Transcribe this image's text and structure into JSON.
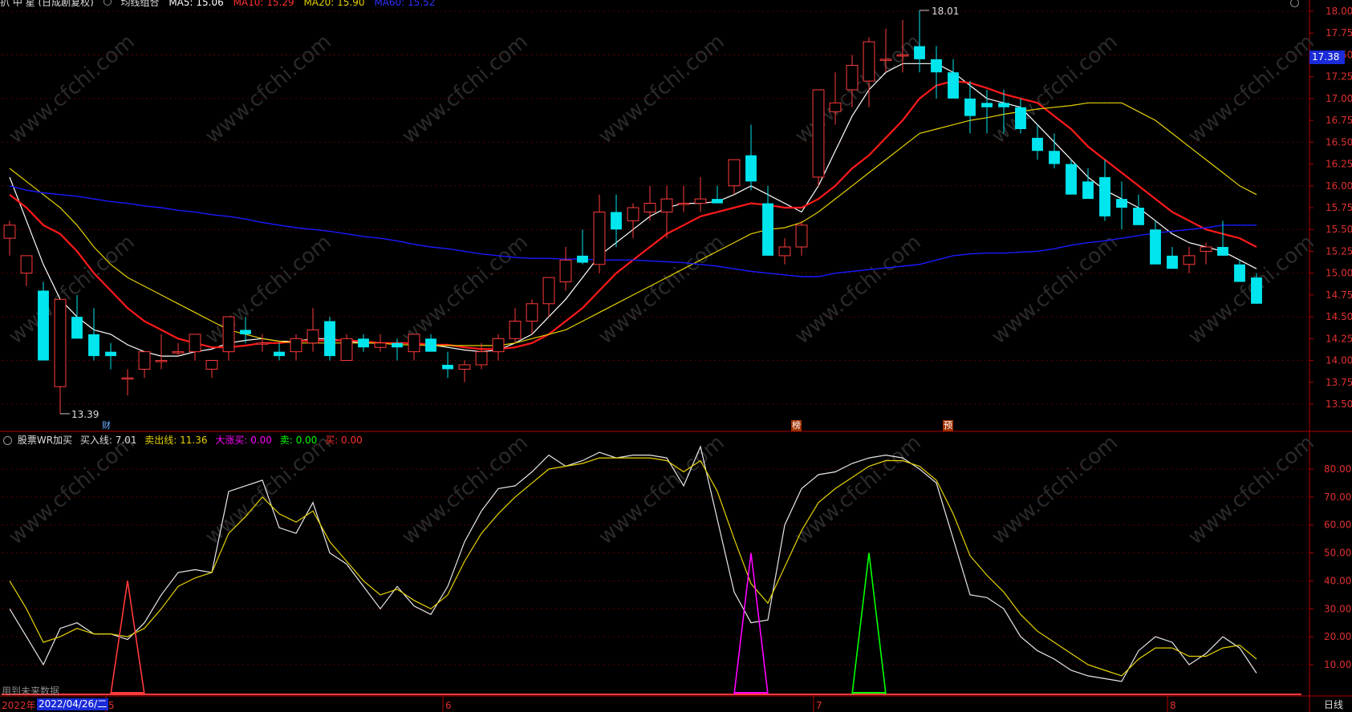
{
  "header": {
    "code_label": "扒 中 星 (日成剧复权)",
    "ma_title": "均线组合",
    "ma5": "MA5: 15.06",
    "ma10": "MA10: 15.29",
    "ma20": "MA20: 15.90",
    "ma60": "MA60: 15.52"
  },
  "price_axis": {
    "ticks": [
      "18.00",
      "17.75",
      "17.50",
      "17.25",
      "17.00",
      "16.75",
      "16.50",
      "16.25",
      "16.00",
      "15.75",
      "15.50",
      "15.25",
      "15.00",
      "14.75",
      "14.50",
      "14.25",
      "14.00",
      "13.75",
      "13.50"
    ],
    "current_price": "17.38"
  },
  "annotations": {
    "high_label": "18.01",
    "low_label": "13.39",
    "marker_cai": "财",
    "marker_bang": "榜",
    "marker_yu": "预"
  },
  "indicator": {
    "name": "股票WR加买",
    "buy_line": "买入线: 7.01",
    "sell_line": "卖出线: 11.36",
    "big_buy": "大涨买: 0.00",
    "sell": "卖: 0.00",
    "buy": "买: 0.00",
    "ticks": [
      "80.00",
      "70.00",
      "60.00",
      "50.00",
      "40.00",
      "30.00",
      "20.00",
      "10.00"
    ]
  },
  "time_axis": {
    "year": "2022年",
    "cursor_date": "2022/04/26/二",
    "months": [
      "5",
      "6",
      "7",
      "8"
    ],
    "period": "日线"
  },
  "footer": {
    "future_data_note": "用到未来数据"
  },
  "colors": {
    "up": "#ff3b3b",
    "down": "#00e5ee",
    "ma5": "#ffffff",
    "ma10": "#ff1a1a",
    "ma20": "#e6d200",
    "ma60": "#1a1aff",
    "axis_red": "#b00000",
    "magenta": "#ff00ff",
    "green": "#00ff00"
  },
  "chart_data": [
    {
      "type": "candlestick",
      "ylim": [
        13.3,
        18.1
      ],
      "candles": [
        [
          15.4,
          15.6,
          15.2,
          15.55
        ],
        [
          15.0,
          15.0,
          14.85,
          15.2
        ],
        [
          14.8,
          14.9,
          14.0,
          14.0
        ],
        [
          13.7,
          14.7,
          13.39,
          14.7
        ],
        [
          14.5,
          14.75,
          14.3,
          14.25
        ],
        [
          14.3,
          14.6,
          14.0,
          14.05
        ],
        [
          14.1,
          14.2,
          13.9,
          14.05
        ],
        [
          13.8,
          13.9,
          13.6,
          13.8
        ],
        [
          13.9,
          14.1,
          13.8,
          14.1
        ],
        [
          14.0,
          14.3,
          13.9,
          14.0
        ],
        [
          14.1,
          14.2,
          14.05,
          14.1
        ],
        [
          14.1,
          14.3,
          14.0,
          14.3
        ],
        [
          13.9,
          14.0,
          13.8,
          14.0
        ],
        [
          14.1,
          14.5,
          14.0,
          14.5
        ],
        [
          14.35,
          14.5,
          14.2,
          14.3
        ],
        [
          14.2,
          14.3,
          14.1,
          14.2
        ],
        [
          14.1,
          14.2,
          14.0,
          14.05
        ],
        [
          14.1,
          14.3,
          14.0,
          14.25
        ],
        [
          14.2,
          14.6,
          14.1,
          14.35
        ],
        [
          14.45,
          14.5,
          14.0,
          14.05
        ],
        [
          14.0,
          14.3,
          14.0,
          14.25
        ],
        [
          14.25,
          14.3,
          14.1,
          14.15
        ],
        [
          14.15,
          14.3,
          14.1,
          14.2
        ],
        [
          14.2,
          14.25,
          14.0,
          14.15
        ],
        [
          14.1,
          14.3,
          14.0,
          14.3
        ],
        [
          14.25,
          14.3,
          14.1,
          14.1
        ],
        [
          13.95,
          14.1,
          13.8,
          13.9
        ],
        [
          13.9,
          14.0,
          13.75,
          13.95
        ],
        [
          13.95,
          14.2,
          13.9,
          14.1
        ],
        [
          14.1,
          14.3,
          14.0,
          14.25
        ],
        [
          14.25,
          14.6,
          14.2,
          14.45
        ],
        [
          14.45,
          14.7,
          14.3,
          14.65
        ],
        [
          14.65,
          14.9,
          14.5,
          14.95
        ],
        [
          14.9,
          15.3,
          14.8,
          15.15
        ],
        [
          15.2,
          15.5,
          15.1,
          15.12
        ],
        [
          15.1,
          15.9,
          15.0,
          15.7
        ],
        [
          15.7,
          15.9,
          15.3,
          15.5
        ],
        [
          15.6,
          15.8,
          15.4,
          15.75
        ],
        [
          15.7,
          16.0,
          15.6,
          15.8
        ],
        [
          15.7,
          16.0,
          15.4,
          15.85
        ],
        [
          15.8,
          16.0,
          15.7,
          15.8
        ],
        [
          15.8,
          16.1,
          15.7,
          15.85
        ],
        [
          15.85,
          16.0,
          15.8,
          15.8
        ],
        [
          16.0,
          16.3,
          15.9,
          16.3
        ],
        [
          16.35,
          16.7,
          15.95,
          16.05
        ],
        [
          15.8,
          16.0,
          15.2,
          15.2
        ],
        [
          15.2,
          15.4,
          15.1,
          15.3
        ],
        [
          15.3,
          15.6,
          15.2,
          15.55
        ],
        [
          16.1,
          17.1,
          16.0,
          17.1
        ],
        [
          16.85,
          17.3,
          16.7,
          16.95
        ],
        [
          17.1,
          17.5,
          16.9,
          17.38
        ],
        [
          17.2,
          17.7,
          16.9,
          17.65
        ],
        [
          17.45,
          17.8,
          17.3,
          17.45
        ],
        [
          17.5,
          17.9,
          17.3,
          17.5
        ],
        [
          17.6,
          18.01,
          17.3,
          17.45
        ],
        [
          17.45,
          17.6,
          17.0,
          17.3
        ],
        [
          17.3,
          17.45,
          17.2,
          17.0
        ],
        [
          17.0,
          17.2,
          16.6,
          16.8
        ],
        [
          16.95,
          17.1,
          16.6,
          16.9
        ],
        [
          16.95,
          17.1,
          16.6,
          16.9
        ],
        [
          16.9,
          17.0,
          16.6,
          16.65
        ],
        [
          16.55,
          16.7,
          16.3,
          16.4
        ],
        [
          16.4,
          16.6,
          16.2,
          16.25
        ],
        [
          16.25,
          16.3,
          15.9,
          15.9
        ],
        [
          16.05,
          16.2,
          15.9,
          15.85
        ],
        [
          16.1,
          16.3,
          15.6,
          15.65
        ],
        [
          15.85,
          16.05,
          15.5,
          15.75
        ],
        [
          15.75,
          15.9,
          15.6,
          15.55
        ],
        [
          15.5,
          15.6,
          15.1,
          15.1
        ],
        [
          15.2,
          15.3,
          15.05,
          15.05
        ],
        [
          15.1,
          15.3,
          15.0,
          15.2
        ],
        [
          15.25,
          15.35,
          15.1,
          15.3
        ],
        [
          15.3,
          15.6,
          15.2,
          15.2
        ],
        [
          15.1,
          15.15,
          14.9,
          14.9
        ],
        [
          14.95,
          15.0,
          14.65,
          14.65
        ]
      ],
      "candle_order": "open,high,low,close",
      "ma_series": [
        {
          "name": "MA5",
          "values": [
            16.1,
            15.6,
            15.1,
            14.7,
            14.5,
            14.35,
            14.3,
            14.18,
            14.1,
            14.05,
            14.05,
            14.1,
            14.13,
            14.2,
            14.23,
            14.25,
            14.22,
            14.22,
            14.25,
            14.25,
            14.22,
            14.2,
            14.2,
            14.2,
            14.2,
            14.18,
            14.15,
            14.12,
            14.1,
            14.12,
            14.2,
            14.3,
            14.5,
            14.7,
            14.95,
            15.2,
            15.35,
            15.5,
            15.65,
            15.75,
            15.8,
            15.8,
            15.82,
            15.9,
            16.0,
            15.9,
            15.8,
            15.7,
            16.0,
            16.4,
            16.8,
            17.1,
            17.3,
            17.4,
            17.4,
            17.4,
            17.3,
            17.15,
            17.0,
            16.95,
            16.9,
            16.7,
            16.5,
            16.3,
            16.1,
            15.95,
            15.85,
            15.75,
            15.6,
            15.45,
            15.35,
            15.3,
            15.25,
            15.15,
            15.05
          ]
        },
        {
          "name": "MA10",
          "values": [
            15.9,
            15.75,
            15.55,
            15.45,
            15.25,
            15.0,
            14.8,
            14.6,
            14.45,
            14.35,
            14.25,
            14.2,
            14.15,
            14.15,
            14.17,
            14.2,
            14.2,
            14.22,
            14.23,
            14.23,
            14.23,
            14.22,
            14.2,
            14.2,
            14.2,
            14.18,
            14.18,
            14.15,
            14.13,
            14.13,
            14.15,
            14.2,
            14.3,
            14.45,
            14.6,
            14.8,
            15.0,
            15.15,
            15.3,
            15.45,
            15.55,
            15.65,
            15.7,
            15.75,
            15.8,
            15.78,
            15.75,
            15.75,
            15.85,
            16.0,
            16.2,
            16.35,
            16.55,
            16.75,
            17.0,
            17.15,
            17.2,
            17.18,
            17.12,
            17.05,
            17.0,
            16.95,
            16.8,
            16.65,
            16.45,
            16.3,
            16.15,
            16.0,
            15.85,
            15.7,
            15.6,
            15.5,
            15.45,
            15.4,
            15.3
          ]
        },
        {
          "name": "MA20",
          "values": [
            16.2,
            16.05,
            15.9,
            15.75,
            15.55,
            15.3,
            15.1,
            14.95,
            14.85,
            14.75,
            14.65,
            14.55,
            14.45,
            14.35,
            14.3,
            14.25,
            14.22,
            14.2,
            14.2,
            14.2,
            14.2,
            14.2,
            14.2,
            14.18,
            14.18,
            14.17,
            14.17,
            14.17,
            14.17,
            14.17,
            14.2,
            14.25,
            14.3,
            14.35,
            14.45,
            14.55,
            14.65,
            14.75,
            14.85,
            14.95,
            15.05,
            15.15,
            15.25,
            15.35,
            15.45,
            15.5,
            15.52,
            15.58,
            15.7,
            15.85,
            16.0,
            16.15,
            16.3,
            16.45,
            16.6,
            16.65,
            16.7,
            16.75,
            16.78,
            16.82,
            16.85,
            16.88,
            16.9,
            16.92,
            16.95,
            16.95,
            16.95,
            16.85,
            16.75,
            16.6,
            16.45,
            16.3,
            16.15,
            16.0,
            15.9
          ]
        },
        {
          "name": "MA60",
          "values": [
            16.0,
            15.95,
            15.92,
            15.9,
            15.88,
            15.85,
            15.82,
            15.8,
            15.77,
            15.75,
            15.72,
            15.7,
            15.67,
            15.65,
            15.62,
            15.58,
            15.55,
            15.52,
            15.5,
            15.48,
            15.45,
            15.42,
            15.4,
            15.37,
            15.33,
            15.3,
            15.28,
            15.25,
            15.22,
            15.2,
            15.18,
            15.17,
            15.17,
            15.16,
            15.16,
            15.15,
            15.15,
            15.15,
            15.14,
            15.13,
            15.12,
            15.1,
            15.08,
            15.05,
            15.02,
            15.0,
            14.98,
            14.96,
            14.96,
            15.0,
            15.02,
            15.04,
            15.06,
            15.08,
            15.1,
            15.15,
            15.2,
            15.22,
            15.23,
            15.23,
            15.24,
            15.25,
            15.28,
            15.32,
            15.35,
            15.37,
            15.4,
            15.43,
            15.46,
            15.48,
            15.5,
            15.52,
            15.55,
            15.55,
            15.55
          ]
        }
      ]
    },
    {
      "type": "line",
      "ylim": [
        0,
        90
      ],
      "series": [
        {
          "name": "买入线",
          "values": [
            30,
            20,
            10,
            23,
            25,
            21,
            21,
            19,
            25,
            35,
            43,
            44,
            43,
            72,
            74,
            76,
            59,
            57,
            68,
            50,
            46,
            38,
            30,
            38,
            31,
            28,
            38,
            54,
            65,
            73,
            74,
            79,
            85,
            81,
            83,
            86,
            84,
            85,
            85,
            84,
            74,
            88,
            62,
            36,
            25,
            26,
            60,
            73,
            78,
            79,
            82,
            84,
            85,
            84,
            80,
            75,
            55,
            35,
            34,
            30,
            20,
            15,
            12,
            8,
            6,
            5,
            4,
            15,
            20,
            18,
            10,
            14,
            20,
            16,
            7
          ]
        },
        {
          "name": "卖出线",
          "values": [
            40,
            30,
            18,
            20,
            23,
            21,
            21,
            20,
            23,
            30,
            38,
            41,
            43,
            57,
            63,
            70,
            64,
            61,
            65,
            54,
            47,
            40,
            35,
            37,
            33,
            30,
            35,
            47,
            57,
            64,
            70,
            75,
            80,
            81,
            82,
            84,
            84,
            84,
            84,
            83,
            79,
            83,
            72,
            55,
            39,
            32,
            45,
            58,
            68,
            73,
            77,
            81,
            83,
            83,
            81,
            76,
            64,
            49,
            42,
            36,
            28,
            22,
            18,
            14,
            10,
            8,
            6,
            12,
            16,
            16,
            13,
            13,
            16,
            17,
            12
          ]
        }
      ],
      "signals": [
        {
          "name": "buy_red",
          "index": 7,
          "value": 40
        },
        {
          "name": "big_buy_magenta",
          "index": 44,
          "value": 50
        },
        {
          "name": "sell_green",
          "index": 51,
          "value": 50
        }
      ]
    }
  ]
}
